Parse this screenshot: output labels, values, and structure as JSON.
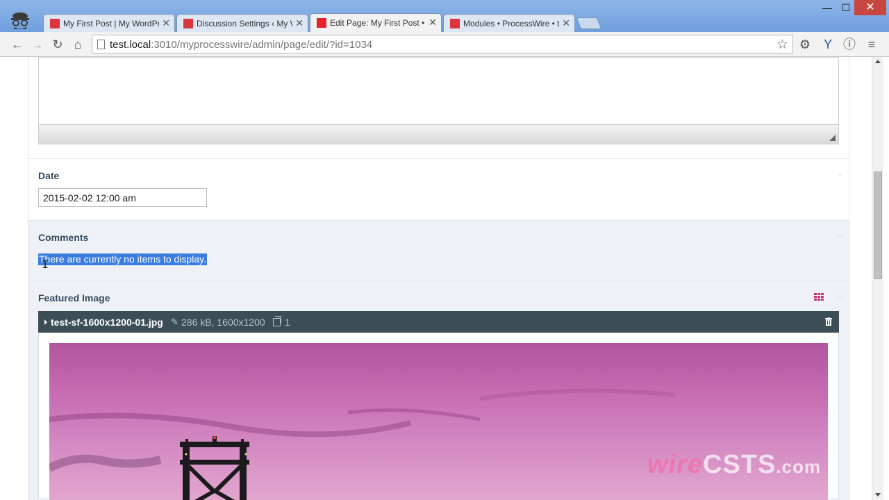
{
  "browser": {
    "tabs": [
      {
        "title": "My First Post | My WordPress",
        "active": false
      },
      {
        "title": "Discussion Settings ‹ My WordPress",
        "active": false
      },
      {
        "title": "Edit Page: My First Post • ProcessWire",
        "active": true
      },
      {
        "title": "Modules • ProcessWire • test",
        "active": false
      }
    ],
    "window_controls": {
      "minimize": "—",
      "maximize": "☐",
      "close": "✕"
    },
    "url_host": "test.local",
    "url_rest": ":3010/myprocesswire/admin/page/edit/?id=1034",
    "icons": [
      "back-icon",
      "forward-icon",
      "reload-icon",
      "home-icon",
      "star-icon",
      "settings-icon",
      "extension-icon",
      "info-icon",
      "menu-icon"
    ]
  },
  "form": {
    "date": {
      "label": "Date",
      "value": "2015-02-02 12:00 am"
    },
    "comments": {
      "label": "Comments",
      "empty_message": "There are currently no items to display."
    },
    "featured_image": {
      "label": "Featured Image",
      "file_name": "test-sf-1600x1200-01.jpg",
      "file_meta": "286 kB, 1600x1200",
      "usage_count": "1"
    }
  },
  "watermark": {
    "part1": "wire",
    "part2": "C",
    "part3": "STS",
    "part4": ".com"
  },
  "colors": {
    "accent": "#3b7dde",
    "file_bar": "#3c4d56",
    "label_text": "#354b60",
    "grid_icon": "#c8327a",
    "tab_favicon": "#d9363e"
  }
}
